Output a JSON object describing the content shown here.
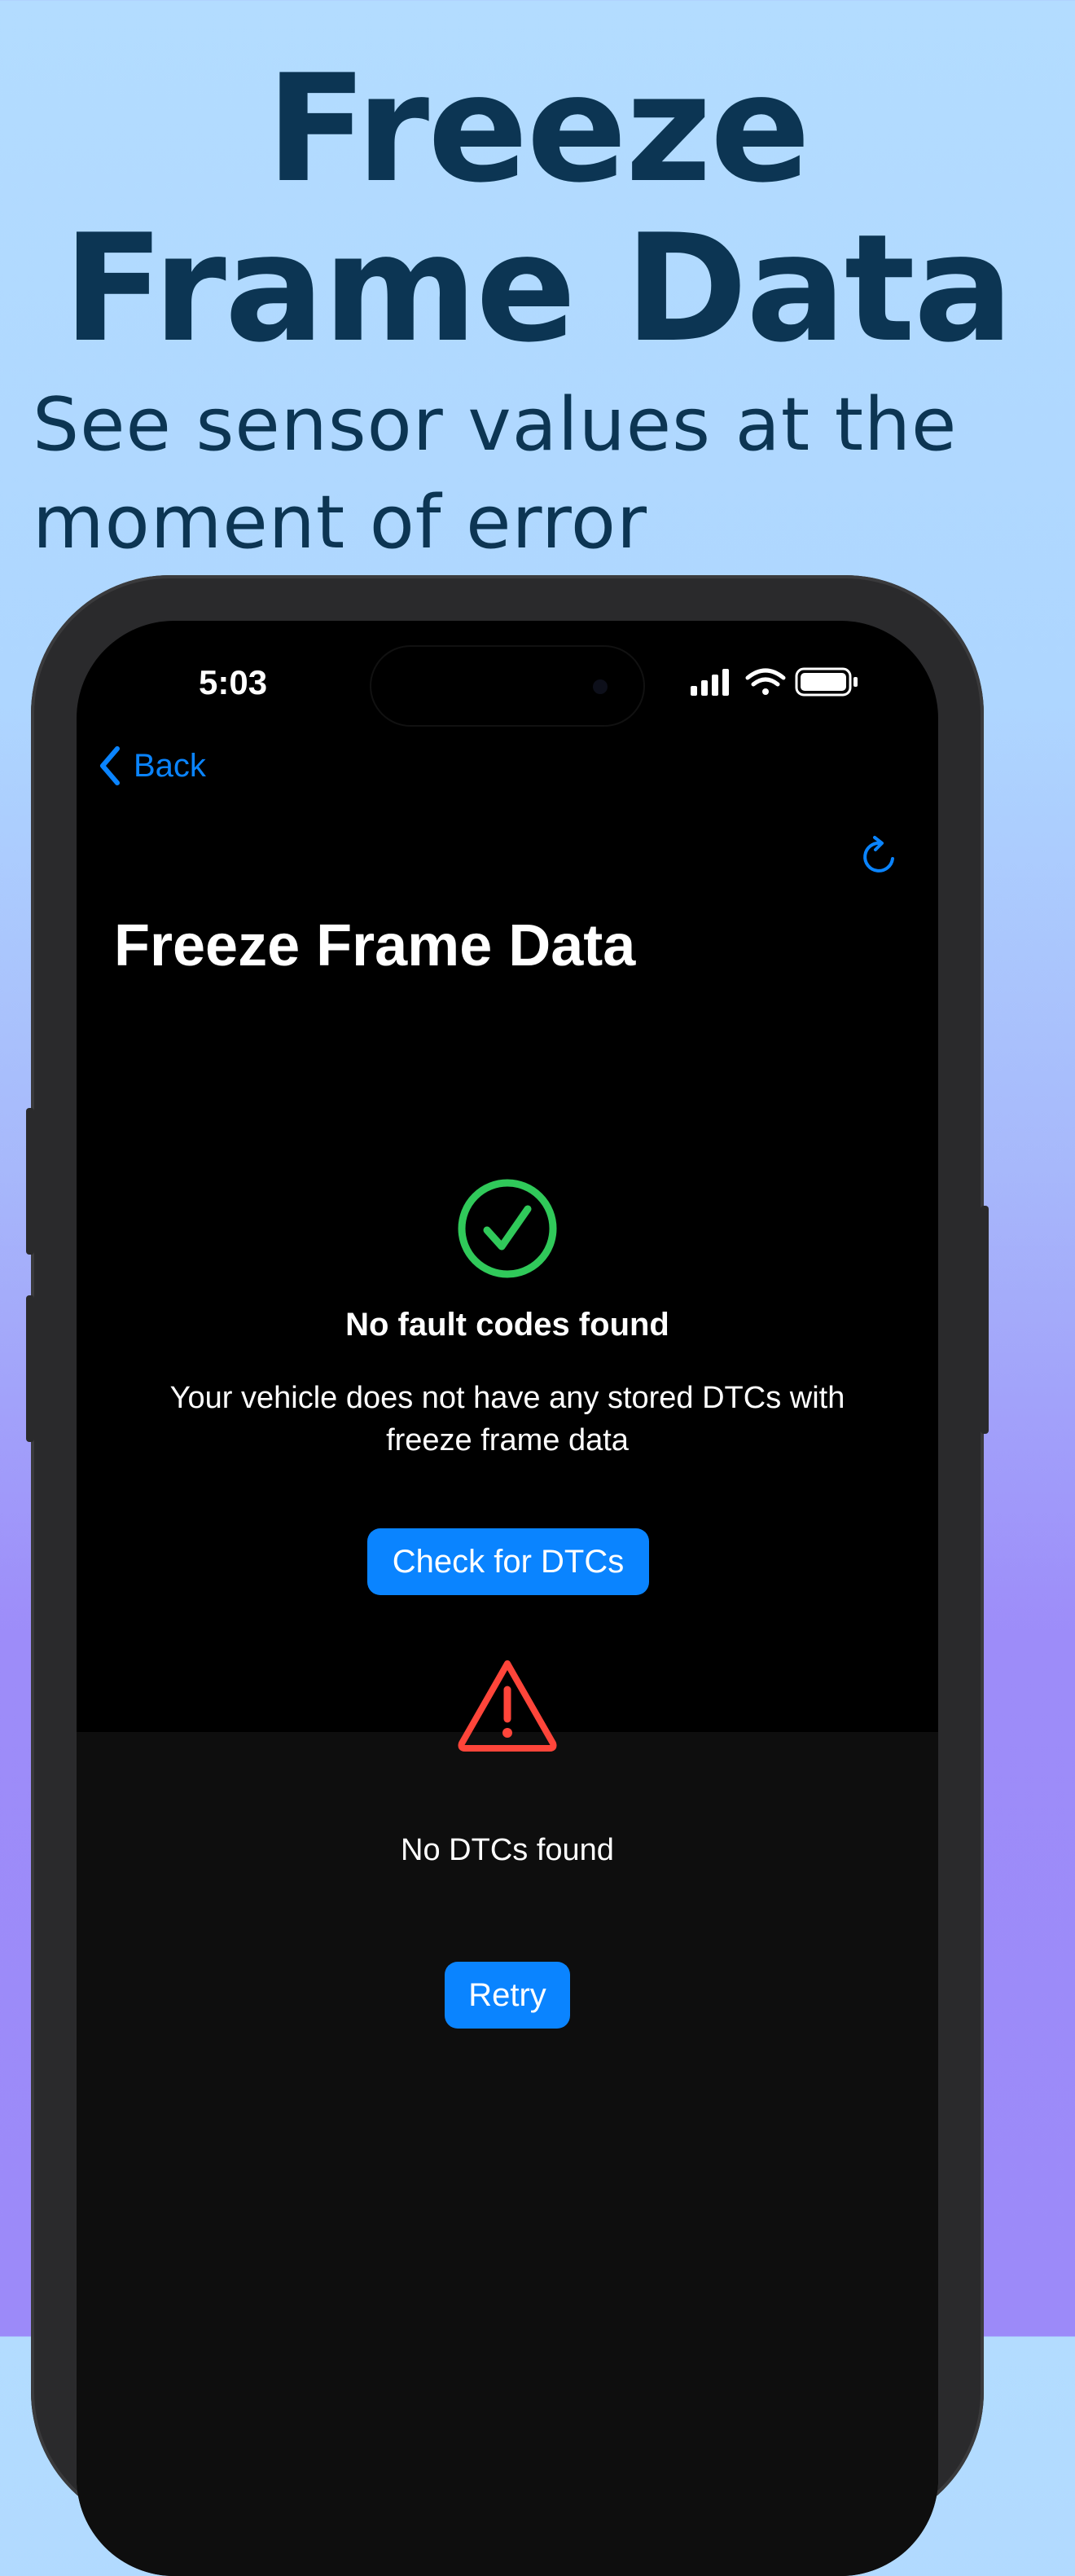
{
  "promo": {
    "headline_line1": "Freeze",
    "headline_line2": "Frame Data",
    "subheadline": "See sensor values at the moment of error"
  },
  "status_bar": {
    "time": "5:03",
    "icons": [
      "cellular-signal-icon",
      "wifi-icon",
      "battery-icon"
    ]
  },
  "nav": {
    "back_label": "Back",
    "title": "Freeze Frame Data",
    "refresh_icon": "refresh-icon"
  },
  "success_state": {
    "icon": "checkmark-circle-icon",
    "title": "No fault codes found",
    "message": "Your vehicle does not have any stored DTCs with freeze frame data",
    "button_label": "Check for DTCs"
  },
  "error_state": {
    "icon": "warning-triangle-icon",
    "title": "No DTCs found",
    "button_label": "Retry"
  },
  "colors": {
    "accent": "#0a84ff",
    "success": "#30c95a",
    "warning": "#ff453a",
    "headline": "#0c3553"
  }
}
